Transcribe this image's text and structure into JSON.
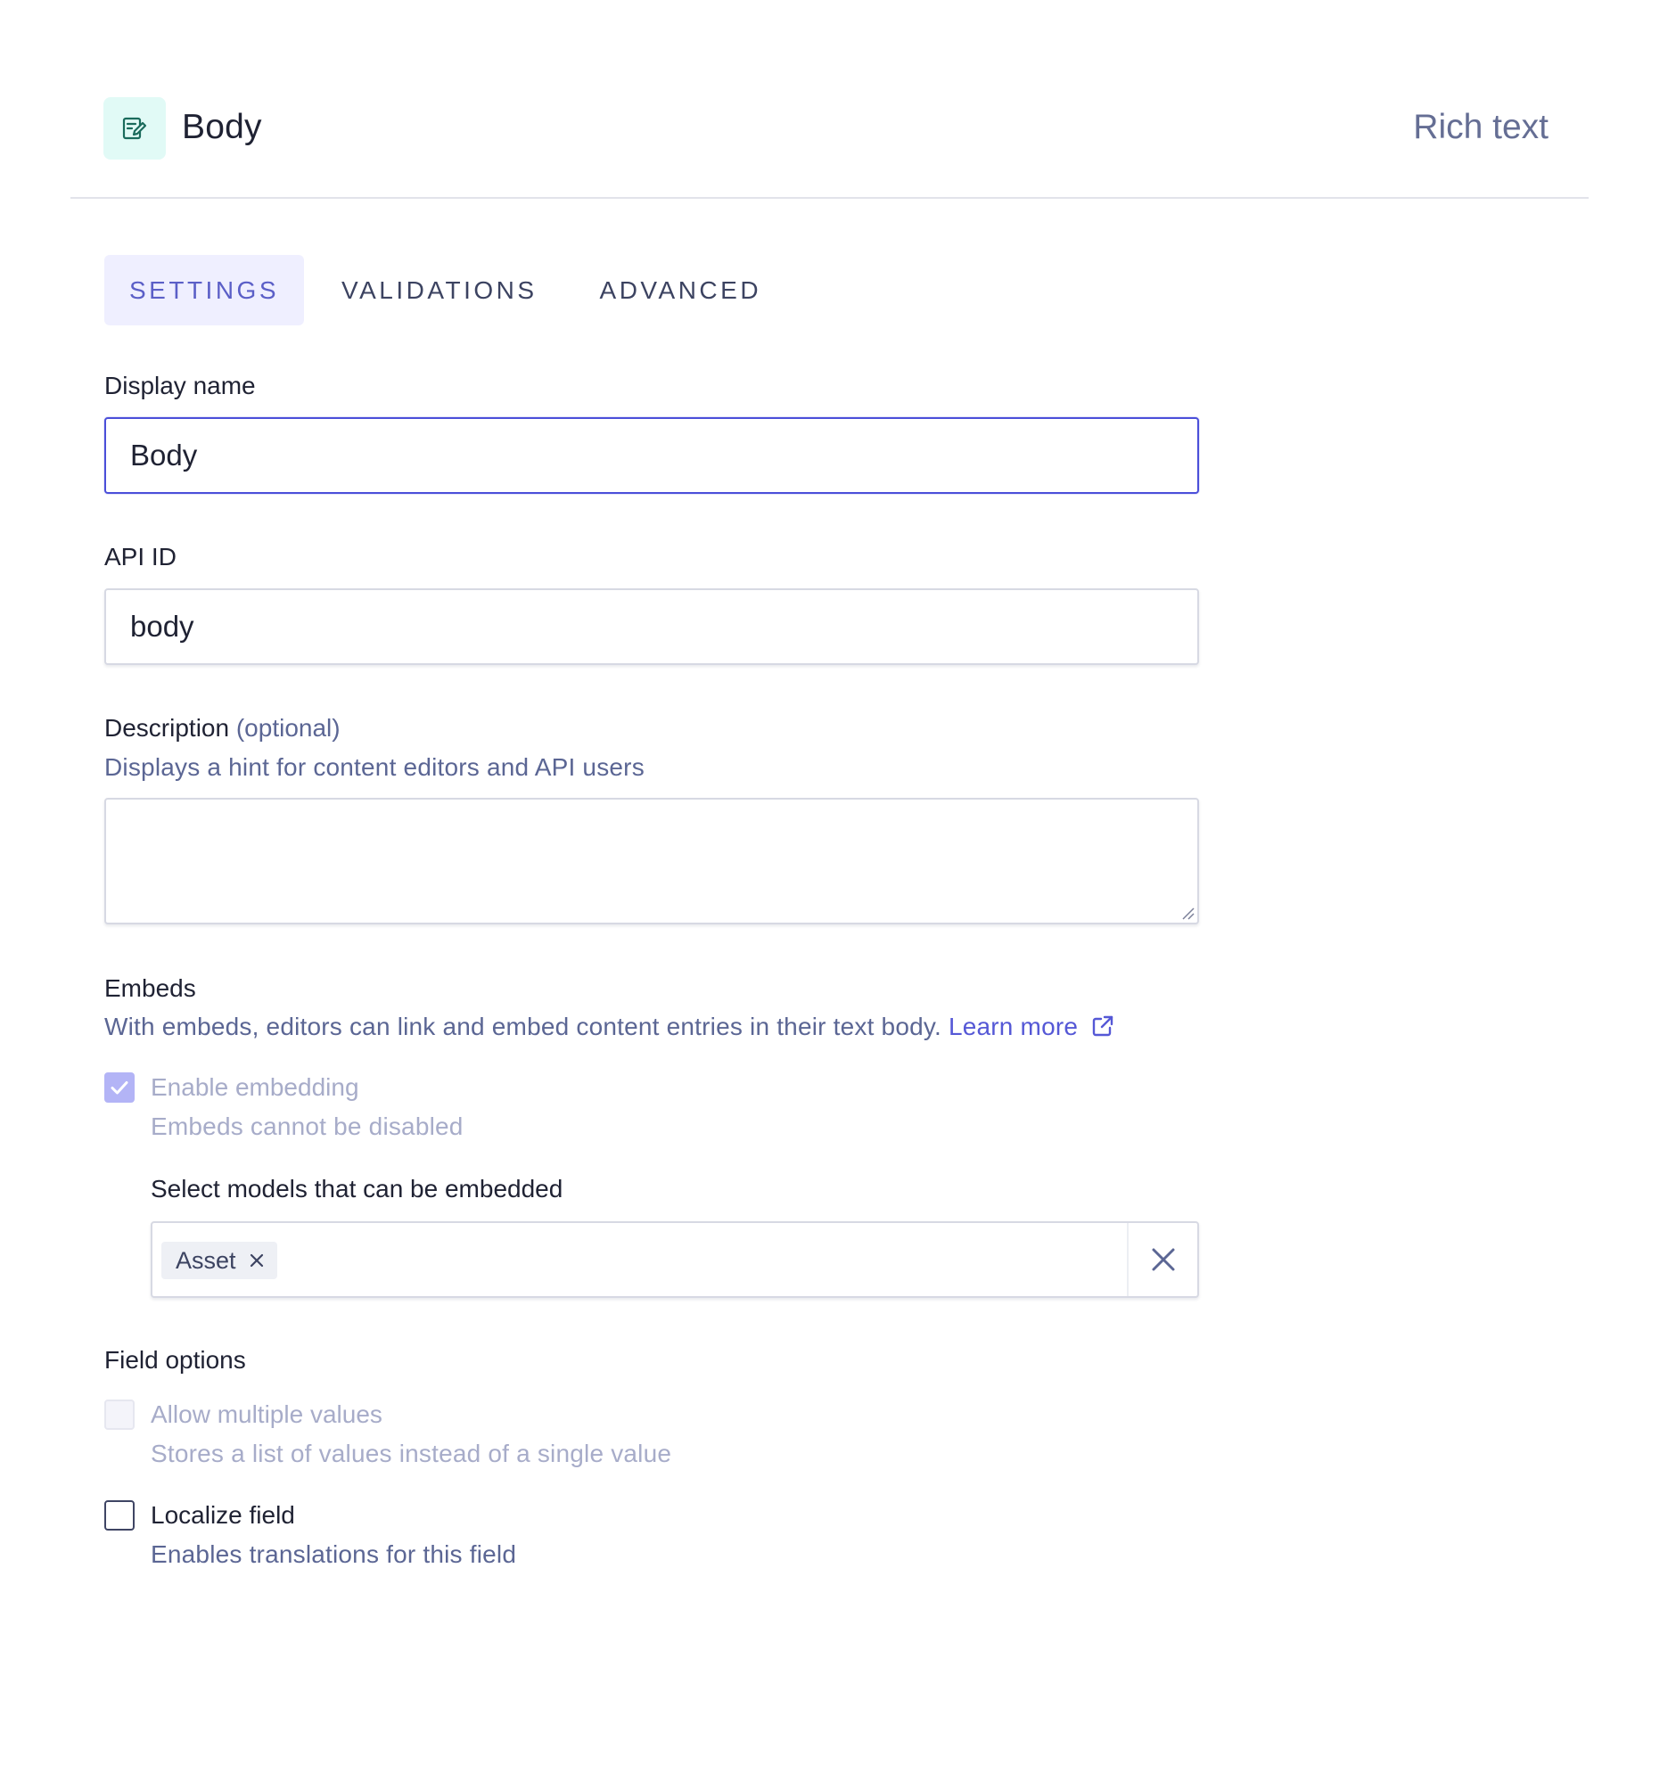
{
  "header": {
    "icon": "rich-text-edit-icon",
    "title": "Body",
    "field_type": "Rich text"
  },
  "tabs": [
    {
      "label": "SETTINGS",
      "active": true
    },
    {
      "label": "VALIDATIONS",
      "active": false
    },
    {
      "label": "ADVANCED",
      "active": false
    }
  ],
  "display_name": {
    "label": "Display name",
    "value": "Body"
  },
  "api_id": {
    "label": "API ID",
    "value": "body"
  },
  "description": {
    "label": "Description",
    "optional": "(optional)",
    "hint": "Displays a hint for content editors and API users",
    "value": ""
  },
  "embeds": {
    "label": "Embeds",
    "hint": "With embeds, editors can link and embed content entries in their text body.",
    "learn_more": "Learn more",
    "enable_label": "Enable embedding",
    "enable_sub": "Embeds cannot be disabled",
    "enable_checked": true,
    "models_label": "Select models that can be embedded",
    "selected_models": [
      "Asset"
    ]
  },
  "field_options": {
    "label": "Field options",
    "multiple_label": "Allow multiple values",
    "multiple_sub": "Stores a list of values instead of a single value",
    "multiple_checked": false,
    "localize_label": "Localize field",
    "localize_sub": "Enables translations for this field",
    "localize_checked": false
  },
  "colors": {
    "accent": "#5b5fc7",
    "focus_border": "#4b4fd9",
    "muted_text": "#5b6694",
    "header_icon_bg": "#e1faf6",
    "header_icon_fg": "#1a6b5c"
  }
}
